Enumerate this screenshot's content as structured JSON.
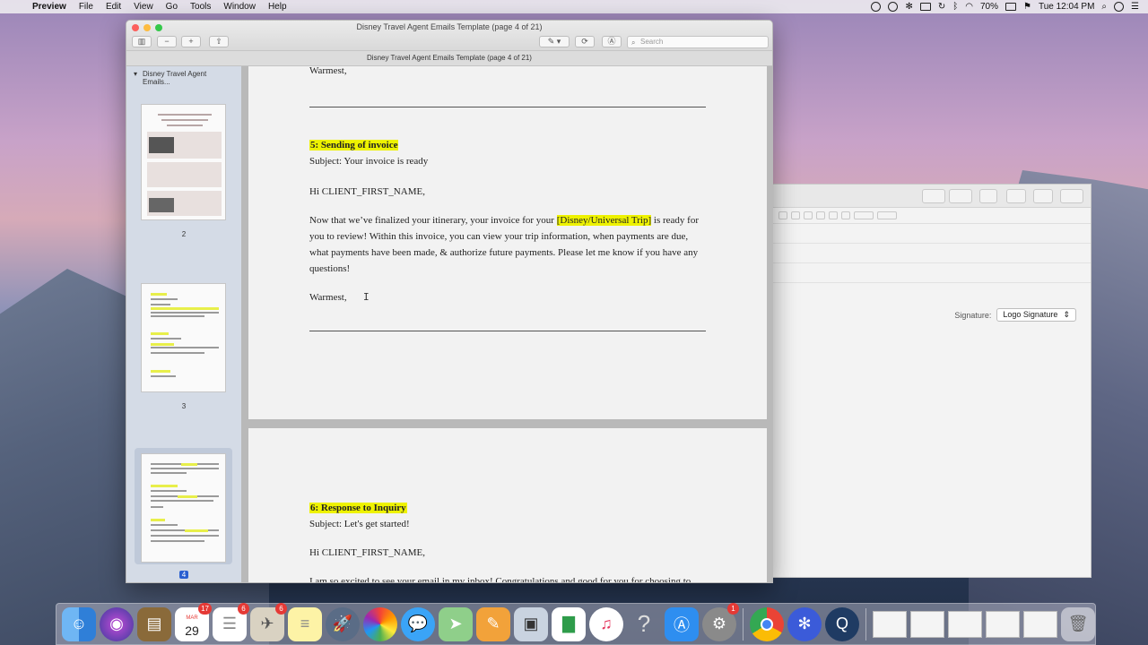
{
  "menubar": {
    "app_name": "Preview",
    "items": [
      "File",
      "Edit",
      "View",
      "Go",
      "Tools",
      "Window",
      "Help"
    ],
    "battery": "70%",
    "clock": "Tue 12:04 PM"
  },
  "window": {
    "title": "Disney Travel Agent Emails Template (page 4 of 21)",
    "subtitle": "Disney Travel Agent Emails Template (page 4 of 21)",
    "search_placeholder": "Search"
  },
  "sidebar": {
    "document_name": "Disney Travel Agent Emails...",
    "pages": [
      {
        "number": "2"
      },
      {
        "number": "3"
      },
      {
        "number": "4"
      }
    ]
  },
  "document": {
    "top_closing": "Warmest,",
    "section5": {
      "heading": "5: Sending of invoice",
      "subject": "Subject: Your invoice is ready",
      "greeting": "Hi CLIENT_FIRST_NAME,",
      "body_before": "Now that we’ve finalized your itinerary, your invoice for your ",
      "body_highlight": "[Disney/Universal Trip]",
      "body_after": " is ready for you to review! Within this invoice, you can view your trip information, when payments are due, what payments have been made, & authorize future payments. Please let me know if you have any questions!",
      "closing": "Warmest,"
    },
    "section6": {
      "heading": "6: Response to Inquiry",
      "subject": "Subject: Let's get started!",
      "greeting": "Hi CLIENT_FIRST_NAME,",
      "body_partial": "I am so excited to see your email in my inbox! Congratulations and good for you for choosing to"
    }
  },
  "mail_window": {
    "signature_label": "Signature:",
    "signature_value": "Logo Signature"
  },
  "dock": {
    "calendar_month": "MAR",
    "calendar_day": "29",
    "badges": {
      "calendar": "17",
      "reminders": "6",
      "preview": "6",
      "system_prefs": "1"
    }
  }
}
